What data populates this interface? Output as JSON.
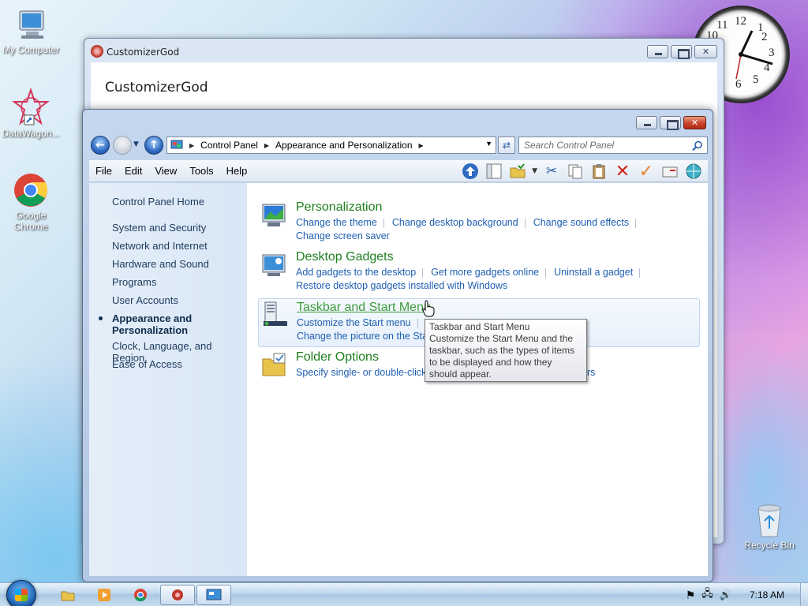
{
  "desktop": {
    "icons": [
      {
        "label": "My Computer"
      },
      {
        "label": "DataWagon..."
      },
      {
        "label": "Google Chrome"
      },
      {
        "label": "Recycle Bin"
      }
    ],
    "clock_numbers": [
      "12",
      "1",
      "2",
      "3",
      "4",
      "5",
      "6",
      "10",
      "11"
    ]
  },
  "back_window": {
    "title": "CustomizerGod",
    "heading": "CustomizerGod"
  },
  "control_panel": {
    "address": {
      "crumbs": [
        "Control Panel",
        "Appearance and Personalization"
      ]
    },
    "search": {
      "placeholder": "Search Control Panel"
    },
    "menu": [
      "File",
      "Edit",
      "View",
      "Tools",
      "Help"
    ],
    "left_nav": {
      "home": "Control Panel Home",
      "items": [
        "System and Security",
        "Network and Internet",
        "Hardware and Sound",
        "Programs",
        "User Accounts"
      ],
      "current_line1": "Appearance and",
      "current_line2": "Personalization",
      "after": [
        "Clock, Language, and Region",
        "Ease of Access"
      ]
    },
    "categories": [
      {
        "title": "Personalization",
        "links": [
          "Change the theme",
          "Change desktop background",
          "Change sound effects"
        ],
        "links2": [
          "Change screen saver"
        ]
      },
      {
        "title": "Desktop Gadgets",
        "links": [
          "Add gadgets to the desktop",
          "Get more gadgets online",
          "Uninstall a gadget"
        ],
        "links2": [
          "Restore desktop gadgets installed with Windows"
        ]
      },
      {
        "title": "Taskbar and Start Menu",
        "links": [
          "Customize the Start menu"
        ],
        "links2": [
          "Change the picture on the Start"
        ]
      },
      {
        "title": "Folder Options",
        "links": [
          "Specify single- or double-click"
        ],
        "links_tail": "ers"
      }
    ],
    "tooltip": {
      "title": "Taskbar and Start Menu",
      "body": "Customize the Start Menu and the taskbar, such as the types of items to be displayed and how they should appear."
    }
  },
  "taskbar": {
    "time": "7:18 AM"
  },
  "colors": {
    "link": "#1f5fb0",
    "category_title": "#1e7f1e",
    "close_button": "#c8442a"
  }
}
